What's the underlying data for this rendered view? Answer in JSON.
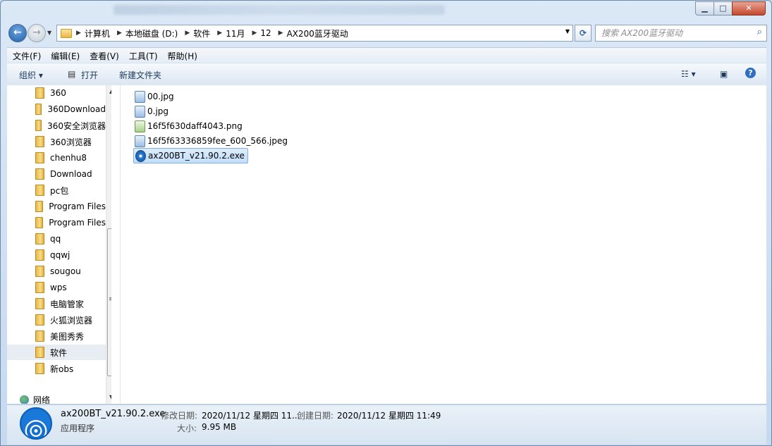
{
  "window": {
    "controls": {
      "minimize": "▁",
      "maximize": "□",
      "close": "✕"
    }
  },
  "nav": {
    "back_icon": "←",
    "forward_icon": "→",
    "dropdown_icon": "▼",
    "breadcrumb": [
      "计算机",
      "本地磁盘 (D:)",
      "软件",
      "11月",
      "12",
      "AX200蓝牙驱动"
    ],
    "refresh_icon": "⟳",
    "search_placeholder": "搜索 AX200蓝牙驱动",
    "search_icon": "⌕"
  },
  "menubar": [
    "文件(F)",
    "编辑(E)",
    "查看(V)",
    "工具(T)",
    "帮助(H)"
  ],
  "commandbar": {
    "organize": "组织 ▾",
    "open": "打开",
    "new_folder": "新建文件夹",
    "view_icon": "☷ ▾",
    "preview_icon": "▣",
    "help_icon": "?"
  },
  "navpane": {
    "folders": [
      "360",
      "360Download",
      "360安全浏览器",
      "360浏览器",
      "chenhu8",
      "Download",
      "pc包",
      "Program Files",
      "Program Files",
      "qq",
      "qqwj",
      "sougou",
      "wps",
      "电脑管家",
      "火狐浏览器",
      "美图秀秀",
      "软件",
      "新obs"
    ],
    "selected_index": 16,
    "network": "网络",
    "scroll_up": "▲",
    "scroll_down": "▼",
    "grip": "≡"
  },
  "files": [
    {
      "name": "00.jpg",
      "type": "jpg"
    },
    {
      "name": "0.jpg",
      "type": "jpg"
    },
    {
      "name": "16f5f630daff4043.png",
      "type": "png"
    },
    {
      "name": "16f5f63336859fee_600_566.jpeg",
      "type": "jpg"
    },
    {
      "name": "ax200BT_v21.90.2.exe",
      "type": "exe",
      "selected": true
    }
  ],
  "details": {
    "filename": "ax200BT_v21.90.2.exe",
    "filetype": "应用程序",
    "modified_label": "修改日期:",
    "modified_value": "2020/11/12 星期四 11...",
    "created_label": "创建日期:",
    "created_value": "2020/11/12 星期四 11:49",
    "size_label": "大小:",
    "size_value": "9.95 MB"
  },
  "colors": {
    "selection": "#cce4fb",
    "window_frame": "#c6d9ee",
    "accent": "#1f5fa8"
  }
}
